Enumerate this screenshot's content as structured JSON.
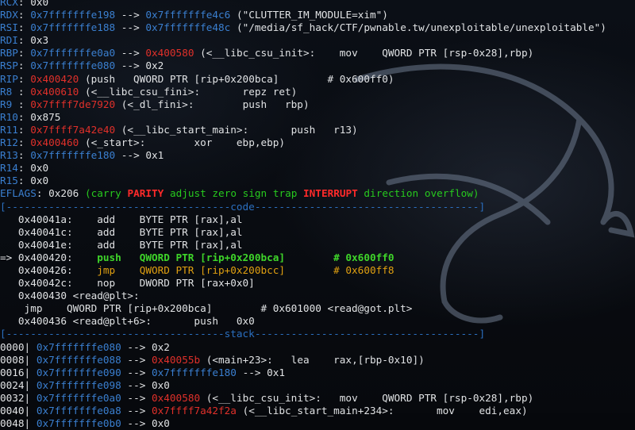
{
  "terminal": {
    "registers": [
      {
        "name": "RCX",
        "parts": [
          {
            "t": "0x0",
            "c": "w"
          }
        ]
      },
      {
        "name": "RDX",
        "parts": [
          {
            "t": "0x7fffffffe198",
            "c": "b"
          },
          {
            "t": " --> ",
            "c": "w"
          },
          {
            "t": "0x7fffffffe4c6",
            "c": "b"
          },
          {
            "t": " (\"CLUTTER_IM_MODULE=xim\")",
            "c": "w"
          }
        ]
      },
      {
        "name": "RSI",
        "parts": [
          {
            "t": "0x7fffffffe188",
            "c": "b"
          },
          {
            "t": " --> ",
            "c": "w"
          },
          {
            "t": "0x7fffffffe48c",
            "c": "b"
          },
          {
            "t": " (\"/media/sf_hack/CTF/pwnable.tw/unexploitable/unexploitable\")",
            "c": "w"
          }
        ]
      },
      {
        "name": "RDI",
        "parts": [
          {
            "t": "0x3",
            "c": "w"
          }
        ]
      },
      {
        "name": "RBP",
        "parts": [
          {
            "t": "0x7fffffffe0a0",
            "c": "b"
          },
          {
            "t": " --> ",
            "c": "w"
          },
          {
            "t": "0x400580",
            "c": "r"
          },
          {
            "t": " (<__libc_csu_init>:    mov    QWORD PTR [rsp-0x28],rbp)",
            "c": "w"
          }
        ]
      },
      {
        "name": "RSP",
        "parts": [
          {
            "t": "0x7fffffffe080",
            "c": "b"
          },
          {
            "t": " --> ",
            "c": "w"
          },
          {
            "t": "0x2",
            "c": "w"
          }
        ]
      },
      {
        "name": "RIP",
        "parts": [
          {
            "t": "0x400420",
            "c": "r"
          },
          {
            "t": " (push   QWORD PTR [rip+0x200bca]        # 0x600ff0)",
            "c": "w"
          }
        ]
      },
      {
        "name": "R8 ",
        "parts": [
          {
            "t": "0x400610",
            "c": "r"
          },
          {
            "t": " (<__libc_csu_fini>:       repz ret)",
            "c": "w"
          }
        ]
      },
      {
        "name": "R9 ",
        "parts": [
          {
            "t": "0x7ffff7de7920",
            "c": "r"
          },
          {
            "t": " (<_dl_fini>:        push   rbp)",
            "c": "w"
          }
        ]
      },
      {
        "name": "R10",
        "parts": [
          {
            "t": "0x875",
            "c": "w"
          }
        ]
      },
      {
        "name": "R11",
        "parts": [
          {
            "t": "0x7ffff7a42e40",
            "c": "r"
          },
          {
            "t": " (<__libc_start_main>:       push   r13)",
            "c": "w"
          }
        ]
      },
      {
        "name": "R12",
        "parts": [
          {
            "t": "0x400460",
            "c": "r"
          },
          {
            "t": " (<_start>:        xor    ebp,ebp)",
            "c": "w"
          }
        ]
      },
      {
        "name": "R13",
        "parts": [
          {
            "t": "0x7fffffffe180",
            "c": "b"
          },
          {
            "t": " --> ",
            "c": "w"
          },
          {
            "t": "0x1",
            "c": "w"
          }
        ]
      },
      {
        "name": "R14",
        "parts": [
          {
            "t": "0x0",
            "c": "w"
          }
        ]
      },
      {
        "name": "R15",
        "parts": [
          {
            "t": "0x0",
            "c": "w"
          }
        ]
      }
    ],
    "eflags": {
      "name": "EFLAGS",
      "value": "0x206",
      "flags": [
        {
          "t": "carry",
          "c": "g"
        },
        {
          "t": "PARITY",
          "c": "rb"
        },
        {
          "t": "adjust",
          "c": "g"
        },
        {
          "t": "zero",
          "c": "g"
        },
        {
          "t": "sign",
          "c": "g"
        },
        {
          "t": "trap",
          "c": "g"
        },
        {
          "t": "INTERRUPT",
          "c": "rb"
        },
        {
          "t": "direction",
          "c": "g"
        },
        {
          "t": "overflow",
          "c": "g"
        }
      ]
    },
    "code_header": "[-------------------------------------code-------------------------------------]",
    "code": [
      [
        {
          "t": "   0x40041a:    add    BYTE PTR [rax],al",
          "c": "w"
        }
      ],
      [
        {
          "t": "   0x40041c:    add    BYTE PTR [rax],al",
          "c": "w"
        }
      ],
      [
        {
          "t": "   0x40041e:    add    BYTE PTR [rax],al",
          "c": "w"
        }
      ],
      [
        {
          "t": "=> 0x400420:    ",
          "c": "w"
        },
        {
          "t": "push   QWORD PTR [rip+0x200bca]        # 0x600ff0",
          "c": "gb"
        }
      ],
      [
        {
          "t": "   0x400426:    ",
          "c": "w"
        },
        {
          "t": "jmp    QWORD PTR [rip+0x200bcc]        # 0x600ff8",
          "c": "ob"
        }
      ],
      [
        {
          "t": "   0x40042c:    nop    DWORD PTR [rax+0x0]",
          "c": "w"
        }
      ],
      [
        {
          "t": "   0x400430 <read@plt>:",
          "c": "w"
        }
      ],
      [
        {
          "t": "    jmp    QWORD PTR [rip+0x200bca]        # 0x601000 <read@got.plt>",
          "c": "w"
        }
      ],
      [
        {
          "t": "   0x400436 <read@plt+6>:       push   0x0",
          "c": "w"
        }
      ]
    ],
    "stack_header": "[------------------------------------stack-------------------------------------]",
    "stack": [
      [
        {
          "t": "0000| ",
          "c": "w"
        },
        {
          "t": "0x7fffffffe080",
          "c": "b"
        },
        {
          "t": " --> 0x2",
          "c": "w"
        }
      ],
      [
        {
          "t": "0008| ",
          "c": "w"
        },
        {
          "t": "0x7fffffffe088",
          "c": "b"
        },
        {
          "t": " --> ",
          "c": "w"
        },
        {
          "t": "0x40055b",
          "c": "r"
        },
        {
          "t": " (<main+23>:   lea    rax,[rbp-0x10])",
          "c": "w"
        }
      ],
      [
        {
          "t": "0016| ",
          "c": "w"
        },
        {
          "t": "0x7fffffffe090",
          "c": "b"
        },
        {
          "t": " --> ",
          "c": "w"
        },
        {
          "t": "0x7fffffffe180",
          "c": "b"
        },
        {
          "t": " --> 0x1",
          "c": "w"
        }
      ],
      [
        {
          "t": "0024| ",
          "c": "w"
        },
        {
          "t": "0x7fffffffe098",
          "c": "b"
        },
        {
          "t": " --> 0x0",
          "c": "w"
        }
      ],
      [
        {
          "t": "0032| ",
          "c": "w"
        },
        {
          "t": "0x7fffffffe0a0",
          "c": "b"
        },
        {
          "t": " --> ",
          "c": "w"
        },
        {
          "t": "0x400580",
          "c": "r"
        },
        {
          "t": " (<__libc_csu_init>:   mov    QWORD PTR [rsp-0x28],rbp)",
          "c": "w"
        }
      ],
      [
        {
          "t": "0040| ",
          "c": "w"
        },
        {
          "t": "0x7fffffffe0a8",
          "c": "b"
        },
        {
          "t": " --> ",
          "c": "w"
        },
        {
          "t": "0x7ffff7a42f2a",
          "c": "r"
        },
        {
          "t": " (<__libc_start_main+234>:       mov    edi,eax)",
          "c": "w"
        }
      ],
      [
        {
          "t": "0048| ",
          "c": "w"
        },
        {
          "t": "0x7fffffffe0b0",
          "c": "b"
        },
        {
          "t": " --> 0x0",
          "c": "w"
        }
      ]
    ]
  }
}
